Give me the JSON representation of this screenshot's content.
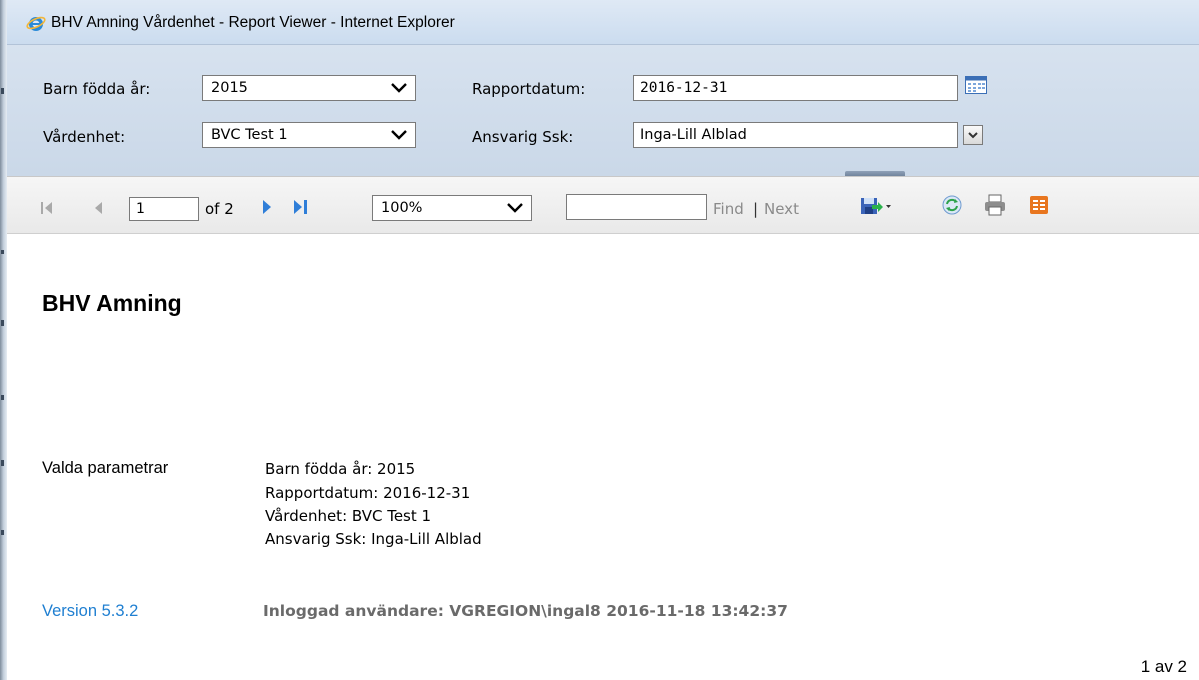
{
  "window": {
    "title": "BHV Amning Vårdenhet - Report Viewer - Internet Explorer",
    "icon": "internet-explorer-icon"
  },
  "parameters": {
    "barn_fodda_ar": {
      "label": "Barn födda år:",
      "value": "2015"
    },
    "rapportdatum": {
      "label": "Rapportdatum:",
      "value": "2016-12-31"
    },
    "vardenhet": {
      "label": "Vårdenhet:",
      "value": "BVC Test 1"
    },
    "ansvarig_ssk": {
      "label": "Ansvarig Ssk:",
      "value": "Inga-Lill Alblad"
    }
  },
  "toolbar": {
    "current_page": "1",
    "of_pages": "of 2",
    "zoom": "100%",
    "find_value": "",
    "find_label": "Find",
    "separator": "|",
    "next_label": "Next",
    "icons": [
      "first-page-icon",
      "previous-page-icon",
      "next-page-icon",
      "last-page-icon",
      "export-icon",
      "refresh-icon",
      "print-icon",
      "data-feed-icon"
    ]
  },
  "report": {
    "title": "BHV Amning",
    "params_label": "Valda parametrar",
    "param_lines": [
      "Barn födda år: 2015",
      "Rapportdatum: 2016-12-31",
      "Vårdenhet: BVC Test 1",
      "Ansvarig Ssk: Inga-Lill Alblad"
    ],
    "version": "Version 5.3.2",
    "inloggad": "Inloggad användare: VGREGION\\ingal8 2016-11-18 13:42:37",
    "page_count": "1 av 2"
  },
  "colors": {
    "titlebar": "#d3e1f1",
    "params_panel": "#cfdbeb",
    "link_blue": "#1f7fd1",
    "muted_text": "#6a6a6a"
  }
}
